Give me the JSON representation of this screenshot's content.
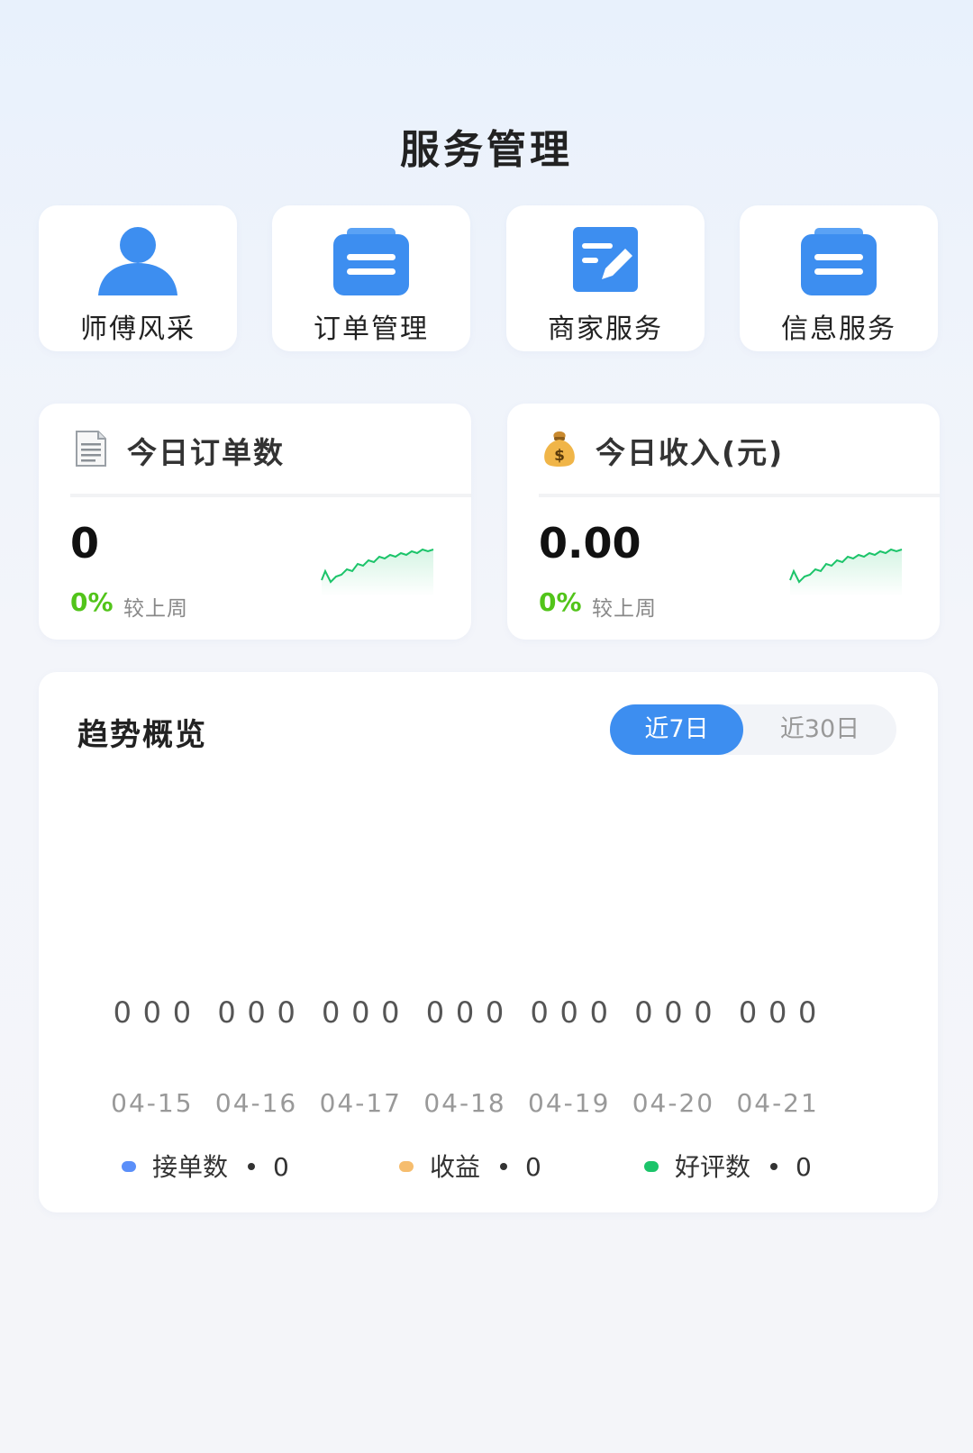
{
  "header": {
    "title": "服务管理"
  },
  "nav": {
    "items": [
      {
        "label": "师傅风采",
        "icon": "user-icon"
      },
      {
        "label": "订单管理",
        "icon": "clipboard-icon"
      },
      {
        "label": "商家服务",
        "icon": "edit-icon"
      },
      {
        "label": "信息服务",
        "icon": "clipboard-icon"
      }
    ],
    "icon_color": "#3d8ef0"
  },
  "stats": [
    {
      "title": "今日订单数",
      "icon": "document-icon",
      "value": "0",
      "change": "0%",
      "compare_label": "较上周"
    },
    {
      "title": "今日收入(元)",
      "icon": "money-bag-icon",
      "value": "0.00",
      "change": "0%",
      "compare_label": "较上周"
    }
  ],
  "trend": {
    "title": "趋势概览",
    "ranges": [
      "近7日",
      "近30日"
    ],
    "active_range": "近7日",
    "legend": [
      {
        "name": "接单数",
        "value": "0",
        "color": "#5b8ff9"
      },
      {
        "name": "收益",
        "value": "0",
        "color": "#f6bd6e"
      },
      {
        "name": "好评数",
        "value": "0",
        "color": "#1cc46a"
      }
    ]
  },
  "chart_data": {
    "type": "bar",
    "categories": [
      "04-15",
      "04-16",
      "04-17",
      "04-18",
      "04-19",
      "04-20",
      "04-21"
    ],
    "series": [
      {
        "name": "接单数",
        "values": [
          0,
          0,
          0,
          0,
          0,
          0,
          0
        ]
      },
      {
        "name": "收益",
        "values": [
          0,
          0,
          0,
          0,
          0,
          0,
          0
        ]
      },
      {
        "name": "好评数",
        "values": [
          0,
          0,
          0,
          0,
          0,
          0,
          0
        ]
      }
    ],
    "data_labels": [
      "0",
      "0",
      "0",
      "0",
      "0",
      "0",
      "0",
      "0",
      "0",
      "0",
      "0",
      "0",
      "0",
      "0",
      "0",
      "0",
      "0",
      "0",
      "0",
      "0",
      "0"
    ],
    "title": "趋势概览",
    "xlabel": "",
    "ylabel": "",
    "grid": false,
    "legend": "bottom",
    "colors": [
      "#5b8ff9",
      "#f6bd6e",
      "#1cc46a"
    ]
  }
}
